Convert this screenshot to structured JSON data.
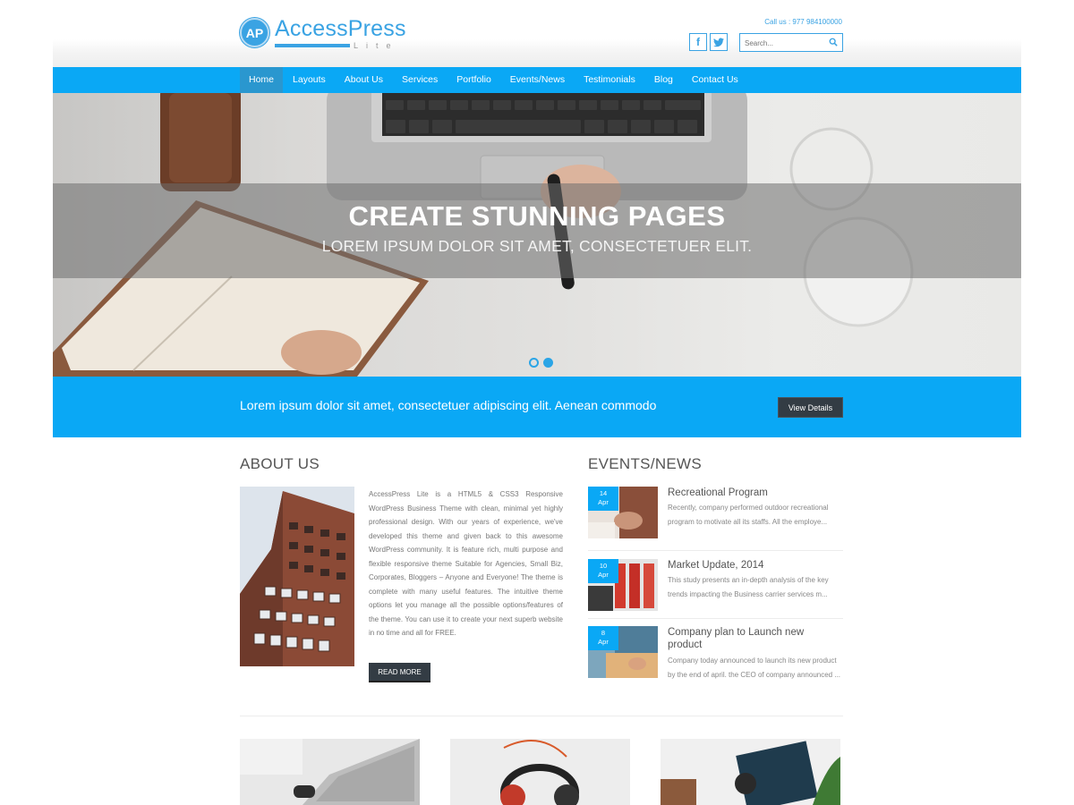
{
  "header": {
    "logo_badge": "AP",
    "logo_title": "AccessPress",
    "logo_sub": "Lite",
    "call_us": "Call us : 977 984100000",
    "search_placeholder": "Search...",
    "social": [
      {
        "name": "facebook-icon",
        "glyph": "f"
      },
      {
        "name": "twitter-icon",
        "glyph": "t"
      }
    ]
  },
  "nav": {
    "items": [
      "Home",
      "Layouts",
      "About Us",
      "Services",
      "Portfolio",
      "Events/News",
      "Testimonials",
      "Blog",
      "Contact Us"
    ],
    "active_index": 0
  },
  "hero": {
    "title": "CREATE STUNNING PAGES",
    "subtitle": "LOREM IPSUM DOLOR SIT AMET, CONSECTETUER ELIT.",
    "slides": 2,
    "active_slide": 2
  },
  "cta": {
    "text": "Lorem ipsum dolor sit amet, consectetuer adipiscing elit. Aenean commodo",
    "button": "View Details"
  },
  "about": {
    "heading": "ABOUT US",
    "body": "AccessPress Lite is a HTML5 & CSS3 Responsive WordPress Business Theme with clean, minimal yet highly professional design. With our years of experience, we've developed this theme and given back to this awesome WordPress community. It is feature rich, multi purpose and flexible responsive theme Suitable for Agencies, Small Biz, Corporates, Bloggers – Anyone and Everyone! The theme is complete with many useful features. The intuitive theme options let you manage all the possible options/features of the theme. You can use it to create your next superb website in no time and all for FREE.",
    "read_more": "READ MORE"
  },
  "events": {
    "heading": "EVENTS/NEWS",
    "items": [
      {
        "day": "14",
        "month": "Apr",
        "title": "Recreational Program",
        "desc": "Recently, company performed outdoor recreational program to motivate all its staffs. All the employe..."
      },
      {
        "day": "10",
        "month": "Apr",
        "title": "Market Update, 2014",
        "desc": "This study presents an in-depth analysis of the key trends impacting the Business carrier services m..."
      },
      {
        "day": "8",
        "month": "Apr",
        "title": "Company plan to Launch new product",
        "desc": "Company today announced to launch its new product by the end of april. the CEO of company announced ..."
      }
    ]
  },
  "colors": {
    "accent": "#0aa8f5",
    "dark_button": "#333c44",
    "logo_blue": "#3aa3e3"
  }
}
